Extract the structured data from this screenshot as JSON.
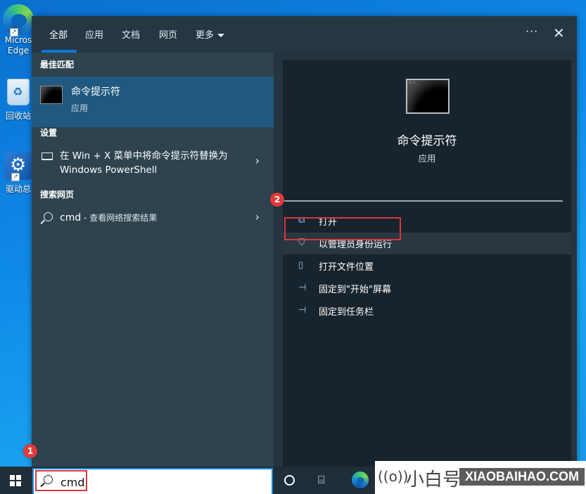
{
  "desktop": {
    "icons": [
      {
        "label_line1": "Micros",
        "label_line2": "Edge",
        "icon": "edge-icon"
      },
      {
        "label_line1": "回收站",
        "icon": "recycle-bin-icon"
      },
      {
        "label_line1": "驱动总",
        "icon": "driver-tool-icon"
      }
    ]
  },
  "search_panel": {
    "tabs": [
      {
        "label": "全部",
        "active": true
      },
      {
        "label": "应用"
      },
      {
        "label": "文档"
      },
      {
        "label": "网页"
      },
      {
        "label": "更多"
      }
    ],
    "more_options_label": "···",
    "close_label": "✕",
    "sections": {
      "best_match": {
        "header": "最佳匹配",
        "title": "命令提示符",
        "subtitle": "应用"
      },
      "settings": {
        "header": "设置",
        "item_text": "在 Win + X 菜单中将命令提示符替换为 Windows PowerShell"
      },
      "web": {
        "header": "搜索网页",
        "query": "cmd",
        "suffix": " - 查看网络搜索结果"
      }
    },
    "chevron": "›",
    "preview": {
      "title": "命令提示符",
      "subtitle": "应用",
      "actions": [
        {
          "label": "打开",
          "icon": "open-icon",
          "glyph": "⧉"
        },
        {
          "label": "以管理员身份运行",
          "icon": "shield-admin-icon",
          "glyph": "⛉",
          "highlighted": true
        },
        {
          "label": "打开文件位置",
          "icon": "folder-location-icon",
          "glyph": "▯"
        },
        {
          "label": "固定到\"开始\"屏幕",
          "icon": "pin-icon",
          "glyph": "⊣"
        },
        {
          "label": "固定到任务栏",
          "icon": "pin-icon",
          "glyph": "⊣"
        }
      ]
    }
  },
  "annotations": {
    "step1": "1",
    "step2": "2",
    "highlight_color": "#d9363e"
  },
  "taskbar": {
    "search_value": "cmd",
    "taskview_glyph": "⌸"
  },
  "brand": {
    "signal": "((o))",
    "name": "小白号",
    "url": "XIAOBAIHAO.COM"
  }
}
